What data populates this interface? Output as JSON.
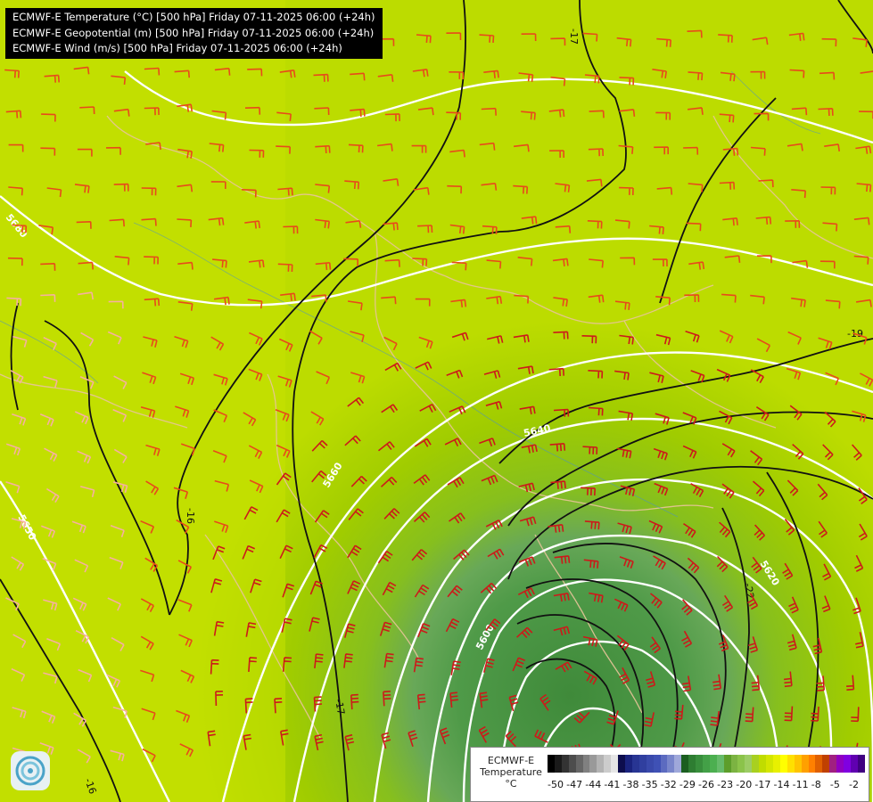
{
  "header": {
    "lines": [
      "ECMWF-E Temperature (°C) [500 hPa] Friday 07-11-2025 06:00 (+24h)",
      "ECMWF-E Geopotential (m) [500 hPa] Friday 07-11-2025 06:00 (+24h)",
      "ECMWF-E Wind (m/s) [500 hPa] Friday 07-11-2025 06:00 (+24h)"
    ]
  },
  "map": {
    "geopotential_labels": [
      "5680",
      "5660",
      "5650",
      "5640",
      "5620",
      "5600",
      "5580"
    ],
    "isotherm_labels": [
      "-17",
      "-16",
      "-17",
      "-19",
      "-22",
      "-16"
    ]
  },
  "legend": {
    "name": "ECMWF-E",
    "variable": "Temperature",
    "unit": "°C",
    "ticks": [
      "-50",
      "-47",
      "-44",
      "-41",
      "-38",
      "-35",
      "-32",
      "-29",
      "-26",
      "-23",
      "-20",
      "-17",
      "-14",
      "-11",
      "-8",
      "-5",
      "-2"
    ],
    "colors": [
      "#000000",
      "#1a1a1a",
      "#333333",
      "#4d4d4d",
      "#666666",
      "#808080",
      "#999999",
      "#b3b3b3",
      "#cccccc",
      "#e6e6e6",
      "#0d0d4d",
      "#1a237e",
      "#283593",
      "#303f9f",
      "#3949ab",
      "#3f51b5",
      "#5c6bc0",
      "#7986cb",
      "#9fa8da",
      "#1b5e20",
      "#2e7d32",
      "#388e3c",
      "#43a047",
      "#4caf50",
      "#66bb6a",
      "#5d9e2a",
      "#7cb342",
      "#8bc34a",
      "#9ccc65",
      "#a8d020",
      "#c0dc00",
      "#d4e600",
      "#e8f000",
      "#ffff00",
      "#ffe000",
      "#ffc400",
      "#ffa000",
      "#ff8000",
      "#e06000",
      "#c04000",
      "#a02080",
      "#9000c0",
      "#8000e0",
      "#6000b0",
      "#400080"
    ]
  }
}
